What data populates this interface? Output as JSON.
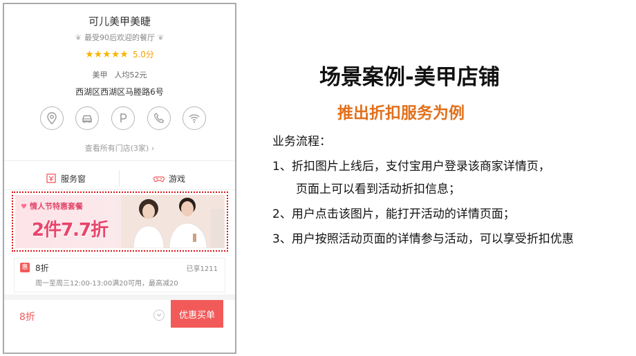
{
  "phone": {
    "shop_name": "可儿美甲美睫",
    "slogan": "最受90后欢迎的餐厅",
    "stars": "★★★★★",
    "rating_score": "5.0分",
    "category": "美甲",
    "avg_price": "人均52元",
    "address": "西湖区西湖区马塍路6号",
    "service_icons": [
      "location-icon",
      "car-icon",
      "parking-icon",
      "phone-icon",
      "wifi-icon"
    ],
    "all_stores": "查看所有门店(3家) ›",
    "menu": [
      {
        "label": "服务窗",
        "icon": "service-window-icon"
      },
      {
        "label": "游戏",
        "icon": "gamepad-icon"
      }
    ],
    "banner": {
      "subtitle": "情人节特惠套餐",
      "main": "2件7.7折"
    },
    "coupon": {
      "badge": "惠",
      "discount": "8折",
      "redeemed": "已享1211",
      "description": "周一至周三12:00-13:00满20可用，最高减20"
    },
    "bottom": {
      "discount": "8折",
      "buy_label": "优惠买单"
    },
    "colors": {
      "accent": "#f25a5a",
      "star": "#f7b500"
    }
  },
  "slide": {
    "title": "场景案例-美甲店铺",
    "subtitle": "推出折扣服务为例",
    "flow_heading": "业务流程：",
    "steps": [
      "1、折扣图片上线后，支付宝用户登录该商家详情页，",
      "页面上可以看到活动折扣信息；",
      "2、用户点击该图片，能打开活动的详情页面；",
      "3、用户按照活动页面的详情参与活动，可以享受折扣优惠"
    ],
    "colors": {
      "subtitle": "#e2701b"
    }
  }
}
